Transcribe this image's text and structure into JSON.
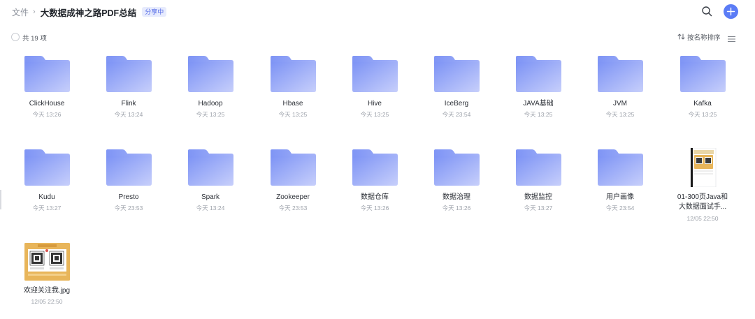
{
  "header": {
    "root": "文件",
    "separator": "›",
    "current": "大数据成神之路PDF总结",
    "badge": "分享中"
  },
  "toolbar": {
    "count_label": "共 19 项",
    "sort_label": "按名称排序"
  },
  "colors": {
    "accent": "#5b7cf6",
    "folder_back": "#8fa3f7",
    "folder_front": "#b3bdf9"
  },
  "icons": {
    "search": "search-icon",
    "add": "plus-icon",
    "sort": "sort-arrows-icon",
    "view": "list-view-icon",
    "folder": "folder-icon"
  },
  "items": [
    {
      "type": "folder",
      "name": "ClickHouse",
      "time": "今天 13:26"
    },
    {
      "type": "folder",
      "name": "Flink",
      "time": "今天 13:24"
    },
    {
      "type": "folder",
      "name": "Hadoop",
      "time": "今天 13:25"
    },
    {
      "type": "folder",
      "name": "Hbase",
      "time": "今天 13:25"
    },
    {
      "type": "folder",
      "name": "Hive",
      "time": "今天 13:25"
    },
    {
      "type": "folder",
      "name": "IceBerg",
      "time": "今天 23:54"
    },
    {
      "type": "folder",
      "name": "JAVA基础",
      "time": "今天 13:25"
    },
    {
      "type": "folder",
      "name": "JVM",
      "time": "今天 13:25"
    },
    {
      "type": "folder",
      "name": "Kafka",
      "time": "今天 13:25"
    },
    {
      "type": "folder",
      "name": "Kudu",
      "time": "今天 13:27"
    },
    {
      "type": "folder",
      "name": "Presto",
      "time": "今天 23:53"
    },
    {
      "type": "folder",
      "name": "Spark",
      "time": "今天 13:24"
    },
    {
      "type": "folder",
      "name": "Zookeeper",
      "time": "今天 23:53"
    },
    {
      "type": "folder",
      "name": "数据仓库",
      "time": "今天 13:26"
    },
    {
      "type": "folder",
      "name": "数据治理",
      "time": "今天 13:26"
    },
    {
      "type": "folder",
      "name": "数据监控",
      "time": "今天 13:27"
    },
    {
      "type": "folder",
      "name": "用户画像",
      "time": "今天 23:54"
    },
    {
      "type": "pdf",
      "name": "01-300页Java和大数据面试手...",
      "time": "12/05 22:50"
    },
    {
      "type": "image",
      "name": "欢迎关注我.jpg",
      "time": "12/05 22:50"
    }
  ]
}
